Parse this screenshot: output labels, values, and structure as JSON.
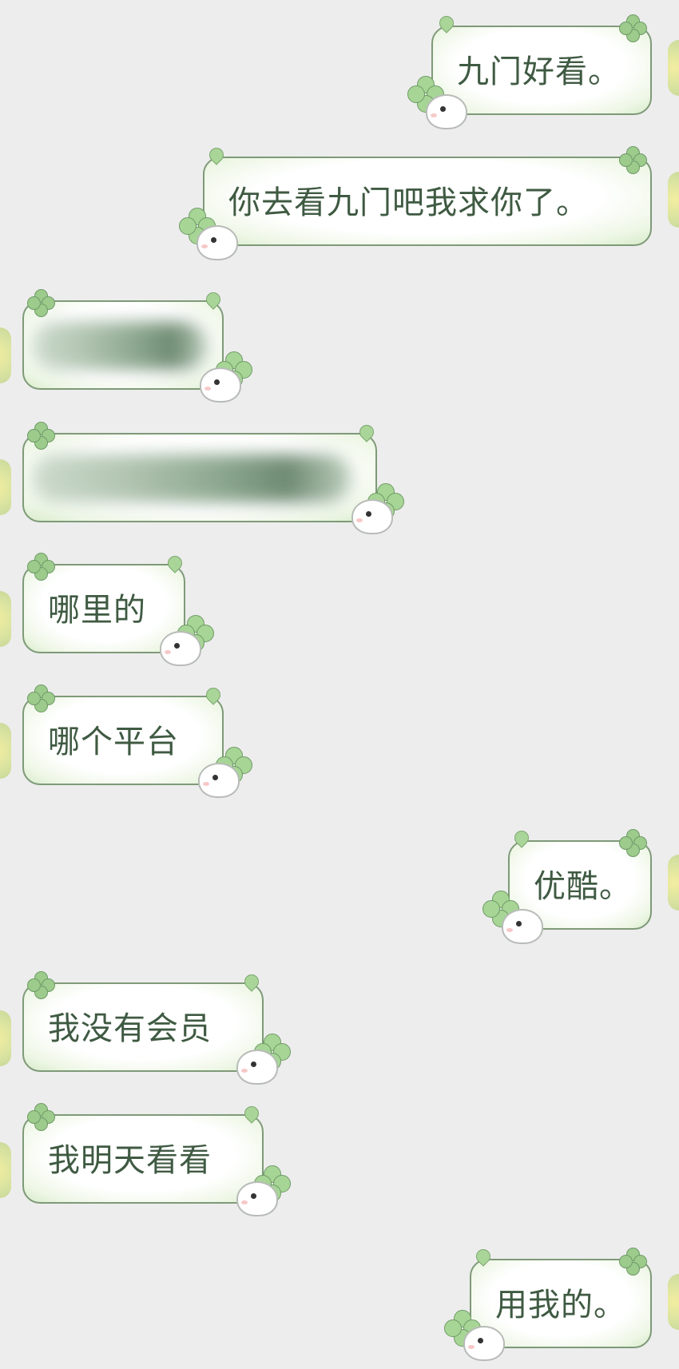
{
  "messages": [
    {
      "side": "right",
      "text": "九门好看。"
    },
    {
      "side": "right",
      "text": "你去看九门吧我求你了。"
    },
    {
      "side": "left",
      "text": "",
      "blurred": true
    },
    {
      "side": "left",
      "text": "",
      "blurred": true
    },
    {
      "side": "left",
      "text": "哪里的"
    },
    {
      "side": "left",
      "text": "哪个平台"
    },
    {
      "side": "right",
      "text": "优酷。"
    },
    {
      "side": "left",
      "text": "我没有会员"
    },
    {
      "side": "left",
      "text": "我明天看看"
    },
    {
      "side": "right",
      "text": "用我的。"
    }
  ],
  "colors": {
    "background": "#ededed",
    "bubble_border": "#7e9a78",
    "bubble_text": "#3f5a42",
    "clover": "#9ccb8c"
  },
  "icons": [
    "clover-icon",
    "sprout-icon",
    "bunny-sticker-icon",
    "avatar"
  ]
}
